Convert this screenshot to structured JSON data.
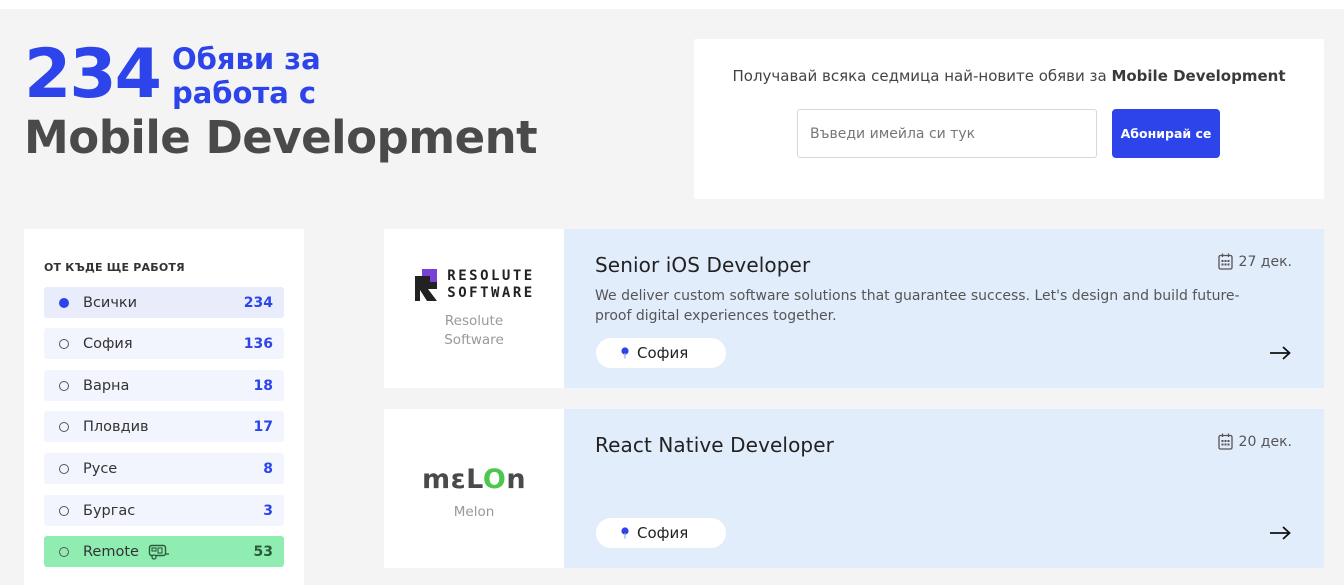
{
  "hero": {
    "count": "234",
    "subtitle_line1": "Обяви за",
    "subtitle_line2": "работа с",
    "title": "Mobile Development"
  },
  "subscribe": {
    "text_prefix": "Получавай всяка седмица най-новите обяви за ",
    "text_bold": "Mobile Development",
    "email_placeholder": "Въведи имейла си тук",
    "button_label": "Абонирай се"
  },
  "sidebar": {
    "heading": "ОТ КЪДЕ ЩЕ РАБОТЯ",
    "items": [
      {
        "label": "Всички",
        "count": "234",
        "selected": true
      },
      {
        "label": "София",
        "count": "136",
        "selected": false
      },
      {
        "label": "Варна",
        "count": "18",
        "selected": false
      },
      {
        "label": "Пловдив",
        "count": "17",
        "selected": false
      },
      {
        "label": "Русе",
        "count": "8",
        "selected": false
      },
      {
        "label": "Бургас",
        "count": "3",
        "selected": false
      },
      {
        "label": "Remote",
        "count": "53",
        "selected": false
      }
    ]
  },
  "jobs": [
    {
      "logo_line1": "RESOLUTE",
      "logo_line2": "SOFTWARE",
      "company": "Resolute Software",
      "title": "Senior iOS Developer",
      "date": "27 дек.",
      "description": "We deliver custom software solutions that guarantee success. Let's design and build future-proof digital experiences together.",
      "location": "София"
    },
    {
      "logo_text": "mɛLOn",
      "company": "Melon",
      "title": "React Native Developer",
      "date": "20 дек.",
      "description": "",
      "location": "София"
    }
  ],
  "colors": {
    "accent": "#2d44ea",
    "card_bg": "#e2edfc",
    "remote_bg": "#8fedb1",
    "melon_green": "#4cc64c"
  }
}
